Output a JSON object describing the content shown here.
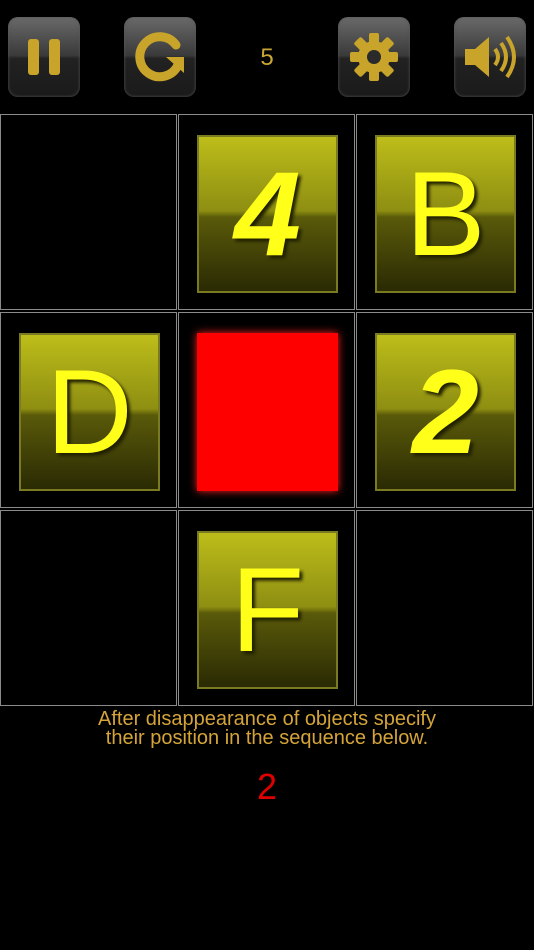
{
  "toolbar": {
    "counter": "5",
    "icon_color": "#c9a42a"
  },
  "board": {
    "rows": [
      [
        {
          "label": ""
        },
        {
          "label": "4"
        },
        {
          "label": "B"
        }
      ],
      [
        {
          "label": "D"
        },
        {
          "label": "",
          "state": "red"
        },
        {
          "label": "2"
        }
      ],
      [
        {
          "label": ""
        },
        {
          "label": "F"
        },
        {
          "label": ""
        }
      ]
    ]
  },
  "instructions": {
    "line1": "After disappearance of objects specify",
    "line2": "their position in the sequence below."
  },
  "sequence": {
    "current": "2",
    "color": "#e00000"
  }
}
